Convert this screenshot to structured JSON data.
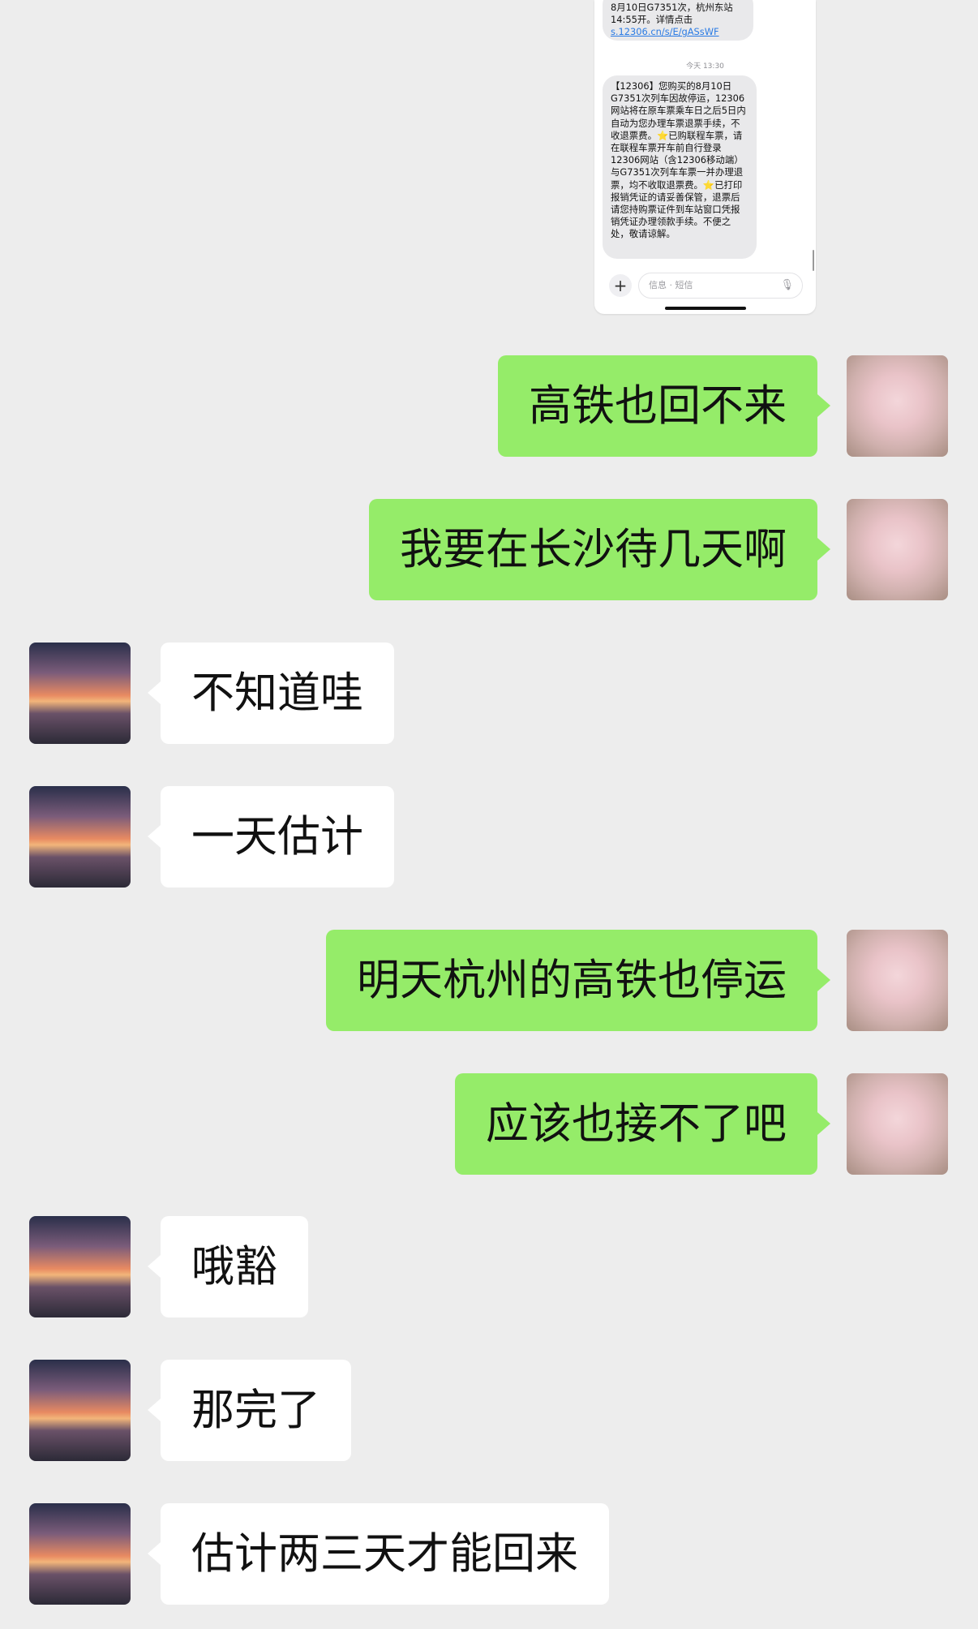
{
  "sms_screenshot": {
    "old_message": "8月10日G7351次，杭州东站14:55开。详情点击",
    "old_link": "s.12306.cn/s/E/gASsWF",
    "time_label": "今天 13:30",
    "new_message": "【12306】您购买的8月10日G7351次列车因故停运，12306网站将在原车票乘车日之后5日内自动为您办理车票退票手续，不收退票费。⭐已购联程车票，请在联程车票开车前自行登录12306网站（含12306移动端）与G7351次列车车票一并办理退票，均不收取退票费。⭐已打印报销凭证的请妥善保管，退票后请您持购票证件到车站窗口凭报销凭证办理领款手续。不便之处，敬请谅解。",
    "input_placeholder": "信息 · 短信",
    "plus_icon": "+",
    "mic_icon": "🎙"
  },
  "messages": [
    {
      "side": "me",
      "text": "高铁也回不来"
    },
    {
      "side": "me",
      "text": "我要在长沙待几天啊"
    },
    {
      "side": "other",
      "text": "不知道哇"
    },
    {
      "side": "other",
      "text": "一天估计"
    },
    {
      "side": "me",
      "text": "明天杭州的高铁也停运"
    },
    {
      "side": "me",
      "text": "应该也接不了吧"
    },
    {
      "side": "other",
      "text": "哦豁"
    },
    {
      "side": "other",
      "text": "那完了"
    },
    {
      "side": "other",
      "text": "估计两三天才能回来"
    }
  ],
  "colors": {
    "background": "#ededed",
    "me_bubble": "#95ec69",
    "other_bubble": "#ffffff"
  }
}
